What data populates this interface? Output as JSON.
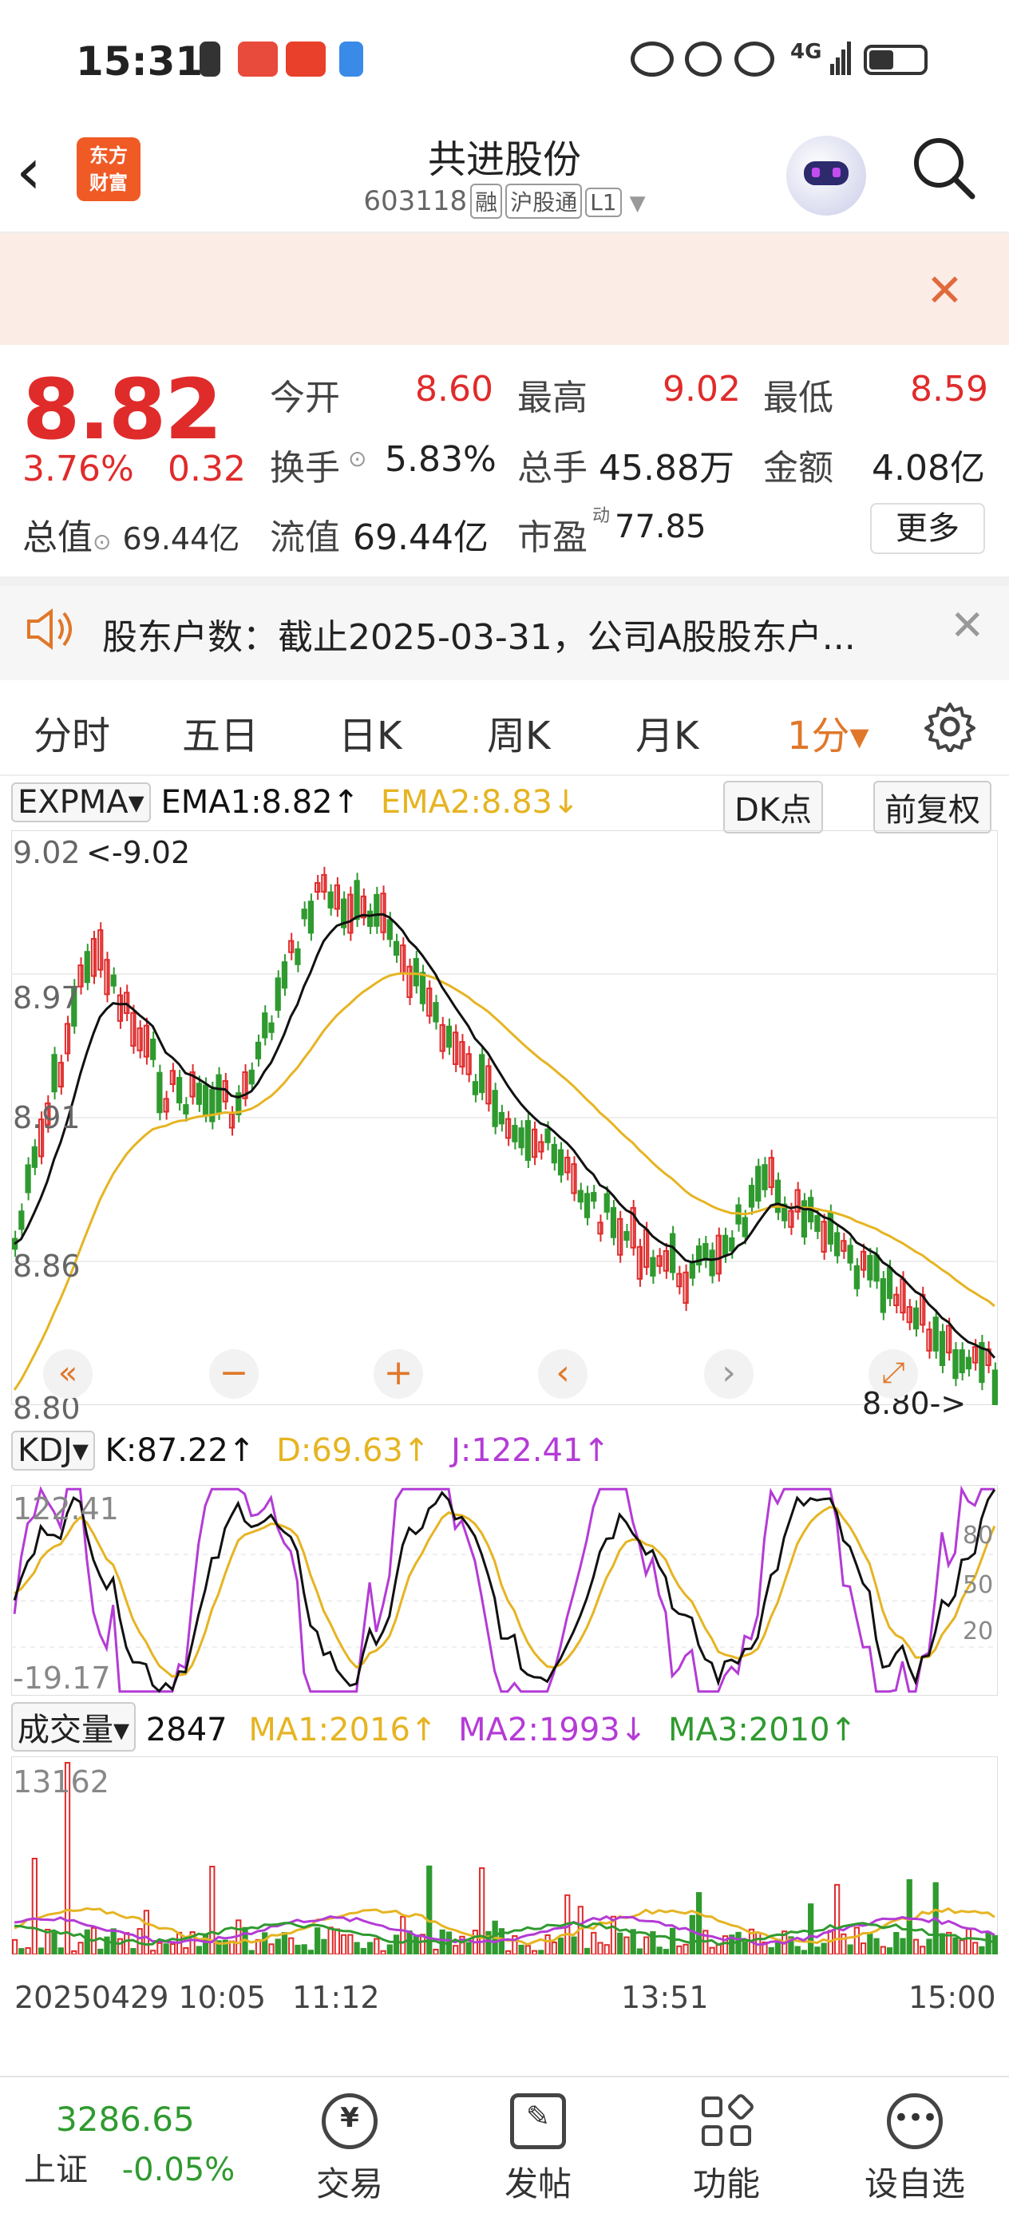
{
  "status_bar": {
    "time": "15:31",
    "network": "4G"
  },
  "header": {
    "logo_line1": "东方",
    "logo_line2": "财富",
    "stock_name": "共进股份",
    "stock_code": "603118",
    "tags": [
      "融",
      "沪股通",
      "L1"
    ]
  },
  "quote": {
    "price": "8.82",
    "change_pct": "3.76%",
    "change_val": "0.32",
    "total_value_label": "总值",
    "total_value": "69.44亿",
    "open_label": "今开",
    "open": "8.60",
    "high_label": "最高",
    "high": "9.02",
    "low_label": "最低",
    "low": "8.59",
    "turnover_label": "换手",
    "turnover": "5.83%",
    "volume_label": "总手",
    "volume": "45.88万",
    "amount_label": "金额",
    "amount": "4.08亿",
    "float_label": "流值",
    "float": "69.44亿",
    "pe_label": "市盈",
    "pe_sup": "动",
    "pe": "77.85",
    "more_label": "更多"
  },
  "notice": {
    "text": "股东户数：截止2025-03-31，公司A股股东户..."
  },
  "tabs": [
    "分时",
    "五日",
    "日K",
    "周K",
    "月K",
    "1分▾"
  ],
  "chart": {
    "indicator": "EXPMA▾",
    "ema1": "EMA1:8.82↑",
    "ema2": "EMA2:8.83↓",
    "dk_label": "DK点",
    "adjust_label": "前复权",
    "price_ticks": [
      "9.02",
      "8.97",
      "8.91",
      "8.86",
      "8.80"
    ],
    "max_marker": "<-9.02",
    "last_marker": "8.80->",
    "kdj_label": "KDJ▾",
    "k_val": "K:87.22↑",
    "d_val": "D:69.63↑",
    "j_val": "J:122.41↑",
    "kdj_top": "122.41",
    "kdj_bottom": "-19.17",
    "kdj_ref": [
      "80",
      "50",
      "20"
    ],
    "vol_label": "成交量▾",
    "vol_val": "2847",
    "ma1": "MA1:2016↑",
    "ma2": "MA2:1993↓",
    "ma3": "MA3:2010↑",
    "vol_top": "13162",
    "time_labels": [
      "20250429 10:05",
      "11:12",
      "13:51",
      "15:00"
    ],
    "colors": {
      "up": "#e02b2b",
      "down": "#2f9a2f",
      "ema1": "#111111",
      "ema2": "#e6b422",
      "j": "#b43bd6"
    }
  },
  "bottom_bar": {
    "index_value": "3286.65",
    "index_name": "上证",
    "index_change": "-0.05%",
    "items": [
      "交易",
      "发帖",
      "功能",
      "设自选"
    ]
  }
}
